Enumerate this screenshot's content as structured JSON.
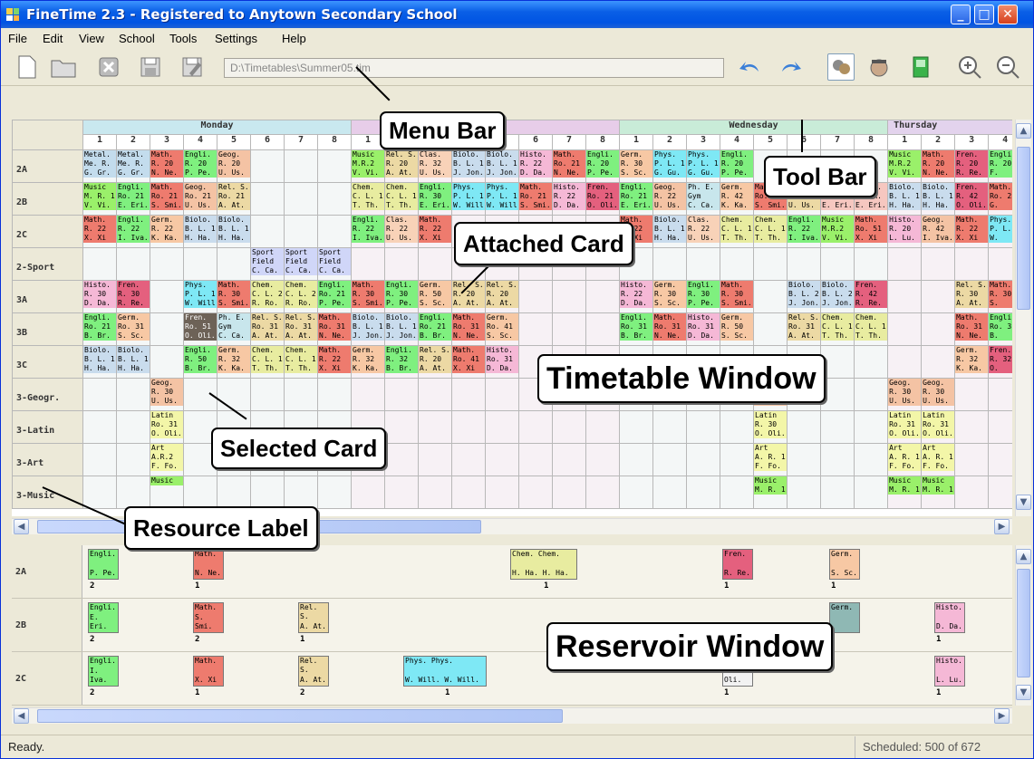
{
  "title": "FineTime 2.3 - Registered to Anytown Secondary School",
  "menu": [
    "File",
    "Edit",
    "View",
    "School",
    "Tools",
    "Settings",
    "Help"
  ],
  "path": "D:\\Timetables\\Summer05.tim",
  "days": [
    "Monday",
    "Tuesday",
    "Wednesday",
    "Thursday"
  ],
  "periods": [
    "1",
    "2",
    "3",
    "4",
    "5",
    "6",
    "7",
    "8"
  ],
  "rows": [
    {
      "label": "2A",
      "cells": [
        [
          "Metal.",
          "Me. R.",
          "G. Gr."
        ],
        [
          "Metal.",
          "Me. R.",
          "G. Gr."
        ],
        [
          "Math.",
          "R. 20",
          "N. Ne."
        ],
        [
          "Engli.",
          "R. 20",
          "P. Pe."
        ],
        [
          "Geog.",
          "R. 20",
          "U. Us."
        ],
        null,
        null,
        null,
        [
          "Music",
          "M.R.2",
          "V. Vi."
        ],
        [
          "Rel. S.",
          "R. 20",
          "A. At."
        ],
        [
          "Clas.",
          "R. 32",
          "U. Us."
        ],
        [
          "Biolo.",
          "B. L. 1",
          "J. Jon."
        ],
        [
          "Biolo.",
          "B. L. 1",
          "J. Jon."
        ],
        [
          "Histo.",
          "R. 22",
          "D. Da."
        ],
        [
          "Math.",
          "Ro. 21",
          "N. Ne."
        ],
        [
          "Engli.",
          "R. 20",
          "P. Pe."
        ],
        [
          "Germ.",
          "R. 30",
          "S. Sc."
        ],
        [
          "Phys.",
          "P. L. 1",
          "G. Gu."
        ],
        [
          "Phys.",
          "P. L. 1",
          "G. Gu."
        ],
        [
          "Engli.",
          "R. 20",
          "P. Pe."
        ],
        null,
        null,
        null,
        null,
        [
          "Music",
          "M.R.2",
          "V. Vi."
        ],
        [
          "Math.",
          "R. 20",
          "N. Ne."
        ],
        [
          "Fren.",
          "R. 20",
          "R. Re."
        ],
        [
          "Engli.",
          "R. 20",
          "F."
        ]
      ]
    },
    {
      "label": "2B",
      "cells": [
        [
          "Music",
          "M. R. 1",
          "V. Vi."
        ],
        [
          "Engli.",
          "Ro. 21",
          "E. Eri."
        ],
        [
          "Math.",
          "Ro. 21",
          "S. Smi."
        ],
        [
          "Geog.",
          "Ro. 21",
          "U. Us."
        ],
        [
          "Rel. S.",
          "Ro. 21",
          "A. At."
        ],
        null,
        null,
        null,
        [
          "Chem.",
          "C. L. 1",
          "T. Th."
        ],
        [
          "Chem.",
          "C. L. 1",
          "T. Th."
        ],
        [
          "Engli.",
          "R. 30",
          "E. Eri."
        ],
        [
          "Phys.",
          "P. L. 1",
          "W. Will."
        ],
        [
          "Phys.",
          "P. L. 1",
          "W. Will."
        ],
        [
          "Math.",
          "Ro. 21",
          "S. Smi."
        ],
        [
          "Histo.",
          "R. 22",
          "D. Da."
        ],
        [
          "Fren.",
          "Ro. 21",
          "O. Oli."
        ],
        [
          "Engli.",
          "Ro. 21",
          "E. Eri."
        ],
        [
          "Geog.",
          "R. 22",
          "U. Us."
        ],
        [
          "Ph. E.",
          "Gym",
          "C. Ca."
        ],
        [
          "Germ.",
          "R. 42",
          "K. Ka."
        ],
        [
          "Math.",
          "Ro. 21",
          "S. Smi."
        ],
        [
          "Rel. S.",
          "Ro. 41",
          "U. Us."
        ],
        [
          "Wo. R.",
          "Wo. R.",
          "E. Eri."
        ],
        [
          "Wo. R.",
          "Wo. R.",
          "E. Eri."
        ],
        [
          "Biolo.",
          "B. L. 1",
          "H. Ha."
        ],
        [
          "Biolo.",
          "B. L. 1",
          "H. Ha."
        ],
        [
          "Fren.",
          "R. 42",
          "O. Oli."
        ],
        [
          "Math.",
          "Ro. 21",
          "G."
        ]
      ]
    },
    {
      "label": "2C",
      "cells": [
        [
          "Math.",
          "R. 22",
          "X. Xi"
        ],
        [
          "Engli.",
          "R. 22",
          "I. Iva."
        ],
        [
          "Germ.",
          "R. 22",
          "K. Ka."
        ],
        [
          "Biolo.",
          "B. L. 1",
          "H. Ha."
        ],
        [
          "Biolo.",
          "B. L. 1",
          "H. Ha."
        ],
        null,
        null,
        null,
        [
          "Engli.",
          "R. 22",
          "I. Iva."
        ],
        [
          "Clas.",
          "R. 22",
          "U. Us."
        ],
        [
          "Math.",
          "R. 22",
          "X. Xi"
        ],
        null,
        null,
        null,
        null,
        null,
        [
          "Math.",
          "R. 22",
          "X. Xi"
        ],
        [
          "Biolo.",
          "B. L. 1",
          "H. Ha."
        ],
        [
          "Clas.",
          "R. 22",
          "U. Us."
        ],
        [
          "Chem.",
          "C. L. 1",
          "T. Th."
        ],
        [
          "Chem.",
          "C. L. 1",
          "T. Th."
        ],
        [
          "Engli.",
          "R. 22",
          "I. Iva."
        ],
        [
          "Music",
          "M.R.2",
          "V. Vi."
        ],
        [
          "Math.",
          "Ro. 51",
          "X. Xi"
        ],
        [
          "Histo.",
          "R. 20",
          "L. Lu."
        ],
        [
          "Geog.",
          "R. 42",
          "I. Iva."
        ],
        [
          "Math.",
          "R. 22",
          "X. Xi"
        ],
        [
          "Phys.",
          "P. L. 1",
          "W."
        ]
      ]
    },
    {
      "label": "2-Sport",
      "cells": [
        null,
        null,
        null,
        null,
        null,
        [
          "Sport",
          "Field",
          "C. Ca."
        ],
        [
          "Sport",
          "Field",
          "C. Ca."
        ],
        [
          "Sport",
          "Field",
          "C. Ca."
        ],
        null,
        null,
        null,
        null,
        null,
        null,
        null,
        null,
        null,
        null,
        null,
        null,
        null,
        null,
        null,
        null,
        null,
        null,
        null,
        null
      ]
    },
    {
      "label": "3A",
      "cells": [
        [
          "Histo.",
          "R. 30",
          "D. Da."
        ],
        [
          "Fren.",
          "R. 30",
          "R. Re."
        ],
        null,
        [
          "Phys.",
          "P. L. 1",
          "W. Will."
        ],
        [
          "Math.",
          "R. 30",
          "S. Smi."
        ],
        [
          "Chem.",
          "C. L. 2",
          "R. Ro."
        ],
        [
          "Chem.",
          "C. L. 2",
          "R. Ro."
        ],
        [
          "Engli.",
          "Ro. 21",
          "P. Pe."
        ],
        [
          "Math.",
          "R. 30",
          "S. Smi."
        ],
        [
          "Engli.",
          "R. 30",
          "P. Pe."
        ],
        [
          "Germ.",
          "R. 50",
          "S. Sc."
        ],
        [
          "Rel. S.",
          "R. 20",
          "A. At."
        ],
        [
          "Rel. S.",
          "R. 20",
          "A. At."
        ],
        null,
        null,
        null,
        [
          "Histo.",
          "R. 22",
          "D. Da."
        ],
        [
          "Germ.",
          "R. 30",
          "S. Sc."
        ],
        [
          "Engli.",
          "R. 30",
          "P. Pe."
        ],
        [
          "Math.",
          "R. 30",
          "S. Smi."
        ],
        null,
        [
          "Biolo.",
          "B. L. 2",
          "J. Jon."
        ],
        [
          "Biolo.",
          "B. L. 2",
          "J. Jon."
        ],
        [
          "Fren.",
          "R. 42",
          "R. Re."
        ],
        null,
        null,
        [
          "Rel. S.",
          "R. 30",
          "A. At."
        ],
        [
          "Math.",
          "R. 30",
          "S."
        ]
      ]
    },
    {
      "label": "3B",
      "cells": [
        [
          "Engli.",
          "Ro. 21",
          "B. Br."
        ],
        [
          "Germ.",
          "Ro. 31",
          "S. Sc."
        ],
        null,
        [
          "Fren.",
          "Ro. 51",
          "O. Oli."
        ],
        [
          "Ph. E.",
          "Gym",
          "C. Ca."
        ],
        [
          "Rel. S.",
          "Ro. 31",
          "A. At."
        ],
        [
          "Rel. S.",
          "Ro. 31",
          "A. At."
        ],
        [
          "Math.",
          "Ro. 31",
          "N. Ne."
        ],
        [
          "Biolo.",
          "B. L. 1",
          "J. Jon."
        ],
        [
          "Biolo.",
          "B. L. 1",
          "J. Jon."
        ],
        [
          "Engli.",
          "Ro. 21",
          "B. Br."
        ],
        [
          "Math.",
          "Ro. 31",
          "N. Ne."
        ],
        [
          "Germ.",
          "Ro. 41",
          "S. Sc."
        ],
        null,
        null,
        null,
        [
          "Engli.",
          "Ro. 31",
          "B. Br."
        ],
        [
          "Math.",
          "Ro. 31",
          "N. Ne."
        ],
        [
          "Histo.",
          "Ro. 31",
          "D. Da."
        ],
        [
          "Germ.",
          "R. 50",
          "S. Sc."
        ],
        null,
        [
          "Rel. S.",
          "Ro. 31",
          "A. At."
        ],
        [
          "Chem.",
          "C. L. 1",
          "T. Th."
        ],
        [
          "Chem.",
          "C. L. 1",
          "T. Th."
        ],
        null,
        null,
        [
          "Math.",
          "Ro. 31",
          "N. Ne."
        ],
        [
          "Engli.",
          "Ro. 31",
          "B."
        ]
      ]
    },
    {
      "label": "3C",
      "cells": [
        [
          "Biolo.",
          "B. L. 1",
          "H. Ha."
        ],
        [
          "Biolo.",
          "B. L. 1",
          "H. Ha."
        ],
        null,
        [
          "Engli.",
          "R. 50",
          "B. Br."
        ],
        [
          "Germ.",
          "R. 32",
          "K. Ka."
        ],
        [
          "Chem.",
          "C. L. 1",
          "T. Th."
        ],
        [
          "Chem.",
          "C. L. 1",
          "T. Th."
        ],
        [
          "Math.",
          "R. 22",
          "X. Xi"
        ],
        [
          "Germ.",
          "R. 32",
          "K. Ka."
        ],
        [
          "Engli.",
          "R. 32",
          "B. Br."
        ],
        [
          "Rel. S.",
          "R. 20",
          "A. At."
        ],
        [
          "Math.",
          "Ro. 41",
          "X. Xi"
        ],
        [
          "Histo.",
          "Ro. 31",
          "D. Da."
        ],
        null,
        null,
        null,
        null,
        null,
        null,
        null,
        null,
        null,
        null,
        null,
        null,
        null,
        [
          "Germ.",
          "R. 32",
          "K. Ka."
        ],
        [
          "Fren.",
          "R. 32",
          "O."
        ]
      ]
    },
    {
      "label": "3-Geogr.",
      "cells": [
        null,
        null,
        [
          "Geog.",
          "R. 30",
          "U. Us."
        ],
        null,
        null,
        null,
        null,
        null,
        null,
        null,
        null,
        null,
        null,
        null,
        null,
        null,
        null,
        null,
        null,
        null,
        [
          "Geog.",
          "Ro. 41",
          "U. Us."
        ],
        null,
        null,
        null,
        [
          "Geog.",
          "R. 30",
          "U. Us."
        ],
        [
          "Geog.",
          "R. 30",
          "U. Us."
        ],
        null,
        null
      ]
    },
    {
      "label": "3-Latin",
      "cells": [
        null,
        null,
        [
          "Latin",
          "Ro. 31",
          "O. Oli."
        ],
        null,
        null,
        null,
        null,
        null,
        null,
        null,
        null,
        null,
        null,
        null,
        null,
        null,
        null,
        null,
        null,
        null,
        [
          "Latin",
          "R. 30",
          "O. Oli."
        ],
        null,
        null,
        null,
        [
          "Latin",
          "Ro. 31",
          "O. Oli."
        ],
        [
          "Latin",
          "Ro. 31",
          "O. Oli."
        ],
        null,
        null
      ]
    },
    {
      "label": "3-Art",
      "cells": [
        null,
        null,
        [
          "Art",
          "A.R.2",
          "F. Fo."
        ],
        null,
        null,
        null,
        null,
        null,
        null,
        null,
        null,
        null,
        null,
        null,
        null,
        null,
        null,
        null,
        null,
        null,
        [
          "Art",
          "A. R. 1",
          "F. Fo."
        ],
        null,
        null,
        null,
        [
          "Art",
          "A. R. 1",
          "F. Fo."
        ],
        [
          "Art",
          "A. R. 1",
          "F. Fo."
        ],
        null,
        null
      ]
    },
    {
      "label": "3-Music",
      "cells": [
        null,
        null,
        [
          "Music",
          "",
          ""
        ],
        null,
        null,
        null,
        null,
        null,
        null,
        null,
        null,
        null,
        null,
        null,
        null,
        null,
        null,
        null,
        null,
        null,
        [
          "Music",
          "M. R. 1",
          ""
        ],
        null,
        null,
        null,
        [
          "Music",
          "M. R. 1",
          ""
        ],
        [
          "Music",
          "M. R. 1",
          ""
        ],
        null,
        null
      ]
    }
  ],
  "reservoir": [
    {
      "label": "2A",
      "cards": [
        {
          "s": "Engli.",
          "t": "P. Pe.",
          "n": "2"
        },
        {
          "s": "Math.",
          "t": "N. Ne.",
          "n": "1"
        },
        {
          "s": "Chem. Chem.",
          "t": "H. Ha. H. Ha.",
          "n": "1"
        },
        {
          "s": "Fren.",
          "t": "R. Re.",
          "n": "1"
        },
        {
          "s": "Germ.",
          "t": "S. Sc.",
          "n": "1"
        }
      ]
    },
    {
      "label": "2B",
      "cards": [
        {
          "s": "Engli.",
          "t": "E. Eri.",
          "n": "2"
        },
        {
          "s": "Math.",
          "t": "S. Smi.",
          "n": "2"
        },
        {
          "s": "Rel. S.",
          "t": "A. At.",
          "n": "1"
        },
        {
          "s": "Germ.",
          "t": "",
          "n": ""
        },
        {
          "s": "Histo.",
          "t": "D. Da.",
          "n": "1"
        }
      ]
    },
    {
      "label": "2C",
      "cards": [
        {
          "s": "Engli.",
          "t": "I. Iva.",
          "n": "2"
        },
        {
          "s": "Math.",
          "t": "X. Xi",
          "n": "1"
        },
        {
          "s": "Rel. S.",
          "t": "A. At.",
          "n": "2"
        },
        {
          "s": "Phys. Phys.",
          "t": "W. Will. W. Will.",
          "n": "1"
        },
        {
          "s": "",
          "t": "O. Oli.",
          "n": "1"
        },
        {
          "s": "Histo.",
          "t": "L. Lu.",
          "n": "1"
        }
      ]
    }
  ],
  "callouts": {
    "menu_bar": "Menu Bar",
    "tool_bar": "Tool Bar",
    "attached_card": "Attached Card",
    "timetable_window": "Timetable Window",
    "selected_card": "Selected Card",
    "resource_label": "Resource Label",
    "reservoir_window": "Reservoir Window"
  },
  "status": {
    "left": "Ready.",
    "right": "Scheduled: 500 of 672"
  },
  "colors": {
    "Engli.": "#7ff07f",
    "Math.": "#ee7b6e",
    "Germ.": "#f7c8a4",
    "Fren.": "#e4607e",
    "Rel. S.": "#ecd9a4",
    "Histo.": "#f5b8d6",
    "Biolo.": "#c9dced",
    "Chem.": "#e8eca0",
    "Phys.": "#7ee8f5",
    "Geog.": "#f4c3a4",
    "Music": "#9af06a",
    "Metal.": "#c3dced",
    "Clas.": "#f8d2b8",
    "Ph. E.": "#c8e6ec",
    "Sport": "#d0d6f8",
    "Latin": "#f3f6a8",
    "Art": "#f3f6a8",
    "Wo. R.": "#f6c7c0"
  },
  "dayColors": [
    "#c9e8ef",
    "#e7cde9",
    "#c9ecd8",
    "#e3d3ed"
  ]
}
